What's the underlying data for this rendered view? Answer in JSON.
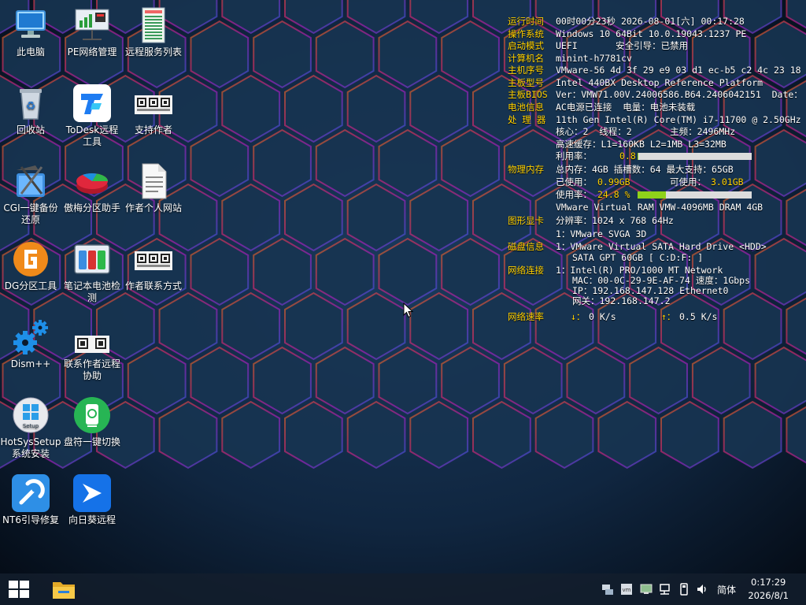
{
  "desktop": {
    "icons": [
      {
        "label": "此电脑"
      },
      {
        "label": "PE网络管理"
      },
      {
        "label": "远程服务列表"
      },
      {
        "label": "回收站"
      },
      {
        "label": "ToDesk远程工具"
      },
      {
        "label": "支持作者"
      },
      {
        "label": "CGI一键备份还原"
      },
      {
        "label": "傲梅分区助手"
      },
      {
        "label": "作者个人网站"
      },
      {
        "label": "DG分区工具"
      },
      {
        "label": "笔记本电池检测"
      },
      {
        "label": "作者联系方式"
      },
      {
        "label": "Dism++"
      },
      {
        "label": "联系作者远程协助"
      },
      {
        "label": "HotSysSetup系统安装"
      },
      {
        "label": "盘符一键切换"
      },
      {
        "label": "NT6引导修复"
      },
      {
        "label": "向日葵远程"
      }
    ]
  },
  "sysinfo": {
    "uptime_k": "运行时间",
    "uptime_v": "00时00分23秒 2026-08-01[六] 00:17:28",
    "os_k": "操作系统",
    "os_v": "Windows 10 64Bit 10.0.19043.1237 PE",
    "boot_k": "启动模式",
    "boot_v": "UEFI       安全引导：已禁用",
    "host_k": "计算机名",
    "host_v": "minint-h7781cv",
    "serial_k": "主机序号",
    "serial_v": "VMware-56 4d 3f 29 e9 03 d1 ec-b5 c2 4c 23 18",
    "board_k": "主板型号",
    "board_v": "Intel 440BX Desktop Reference Platform",
    "bios_k": "主板BIOS",
    "bios_v": "Ver：VMW71.00V.24006586.B64.2406042151  Date：",
    "battery_k": "电池信息",
    "battery_v": "AC电源已连接  电量：电池未装载",
    "cpu_k": "处 理 器",
    "cpu_v": "11th Gen Intel(R) Core(TM) i7-11700 @ 2.50GHz",
    "cpu_cores": "核心：2  线程：2       主频：2496MHz",
    "cpu_cache": "高速缓存：L1=160KB L2=1MB L3=32MB",
    "cpu_use_label": "利用率：",
    "cpu_use_value": "0.8 %",
    "cpu_use_pct": 0.8,
    "mem_k": "物理内存",
    "mem_v": "总内存：4GB 插槽数：64  最大支持：65GB",
    "mem_used_label": "已使用：",
    "mem_used_value": "0.99GB",
    "mem_free_label": "可使用：",
    "mem_free_value": "3.01GB",
    "mem_use_label": "使用率：",
    "mem_use_value": "24.8 %",
    "mem_use_pct": 24.8,
    "mem_module": "VMware Virtual RAM VMW-4096MB DRAM 4GB",
    "gpu_k": "图形显卡",
    "gpu_v": "分辨率：1024 x 768 64Hz",
    "gpu_name": "1：VMware SVGA 3D",
    "disk_k": "磁盘信息",
    "disk_v": "1：VMware Virtual SATA Hard Drive <HDD>",
    "disk_detail": "SATA GPT 60GB [ C:D:F: ]",
    "net_k": "网络连接",
    "net_v": "1：Intel(R) PRO/1000 MT Network",
    "net_mac": "MAC：00-0C-29-9E-AF-74 速度：1Gbps",
    "net_ip": "IP：192.168.147.128 Ethernet0",
    "net_gw": "网关：192.168.147.2",
    "speed_k": "网络速率",
    "down_label": "↓：",
    "down_value": "0 K/s",
    "up_label": "↑：",
    "up_value": "0.5 K/s"
  },
  "taskbar": {
    "ime": "简体",
    "time": "0:17:29",
    "date": "2026/8/1"
  },
  "colors": {
    "label_yellow": "#ffd100",
    "bar_fill": "#8fd11a",
    "bar_bg": "#dcdcdc"
  }
}
